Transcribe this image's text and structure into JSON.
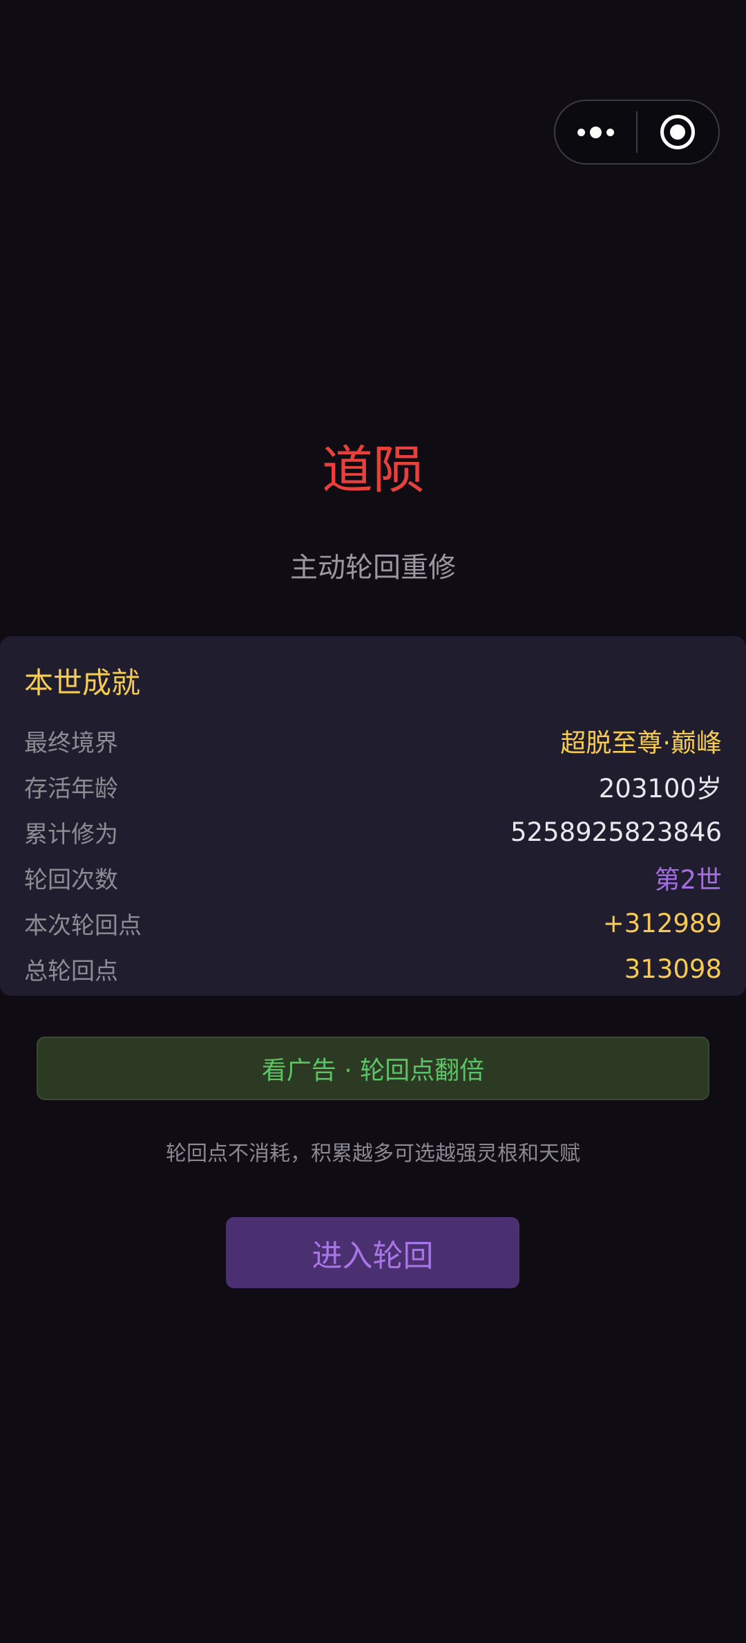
{
  "capsule": {
    "menu_icon": "more-dots-icon",
    "close_icon": "target-circle-icon"
  },
  "header": {
    "title": "道陨",
    "subtitle": "主动轮回重修"
  },
  "summary": {
    "heading": "本世成就",
    "rows": [
      {
        "label": "最终境界",
        "value": "超脱至尊·巅峰"
      },
      {
        "label": "存活年龄",
        "value": "203100岁"
      },
      {
        "label": "累计修为",
        "value": "5258925823846"
      },
      {
        "label": "轮回次数",
        "value": "第2世"
      },
      {
        "label": "本次轮回点",
        "value": "+312989"
      },
      {
        "label": "总轮回点",
        "value": "313098"
      }
    ]
  },
  "actions": {
    "ad_button": "看广告 · 轮回点翻倍",
    "hint": "轮回点不消耗，积累越多可选越强灵根和天赋",
    "enter_button": "进入轮回"
  },
  "colors": {
    "background": "#0f0d13",
    "title": "#e8413d",
    "gold": "#f5cb55",
    "purple": "#a36fe0",
    "green": "#5dc466"
  }
}
